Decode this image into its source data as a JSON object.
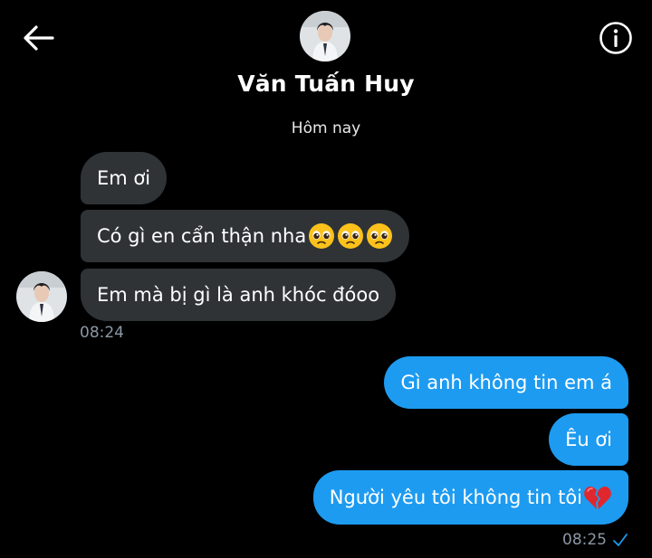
{
  "header": {
    "contact_name": "Văn Tuấn Huy",
    "back_icon": "arrow-left-icon",
    "info_icon": "info-circle-icon",
    "avatar": "contact-avatar"
  },
  "date_separator": "Hôm nay",
  "incoming": {
    "messages": [
      {
        "text": "Em ơi",
        "emoji": []
      },
      {
        "text": "Có gì en cẩn thận nha",
        "emoji": [
          "pleading-face",
          "pleading-face",
          "pleading-face"
        ]
      },
      {
        "text": "Em mà bị gì là anh khóc đóoo",
        "emoji": []
      }
    ],
    "time": "08:24"
  },
  "outgoing": {
    "messages": [
      {
        "text": "Gì anh không tin em á",
        "emoji": []
      },
      {
        "text": "Êu ơi",
        "emoji": []
      },
      {
        "text": "Người yêu tôi không tin tôi",
        "emoji": [
          "broken-heart"
        ]
      }
    ],
    "time": "08:25",
    "status_icon": "read-check-icon"
  },
  "colors": {
    "background": "#000000",
    "incoming_bubble": "#2f3336",
    "outgoing_bubble": "#1d9bf0",
    "timestamp": "#8b98a5"
  }
}
